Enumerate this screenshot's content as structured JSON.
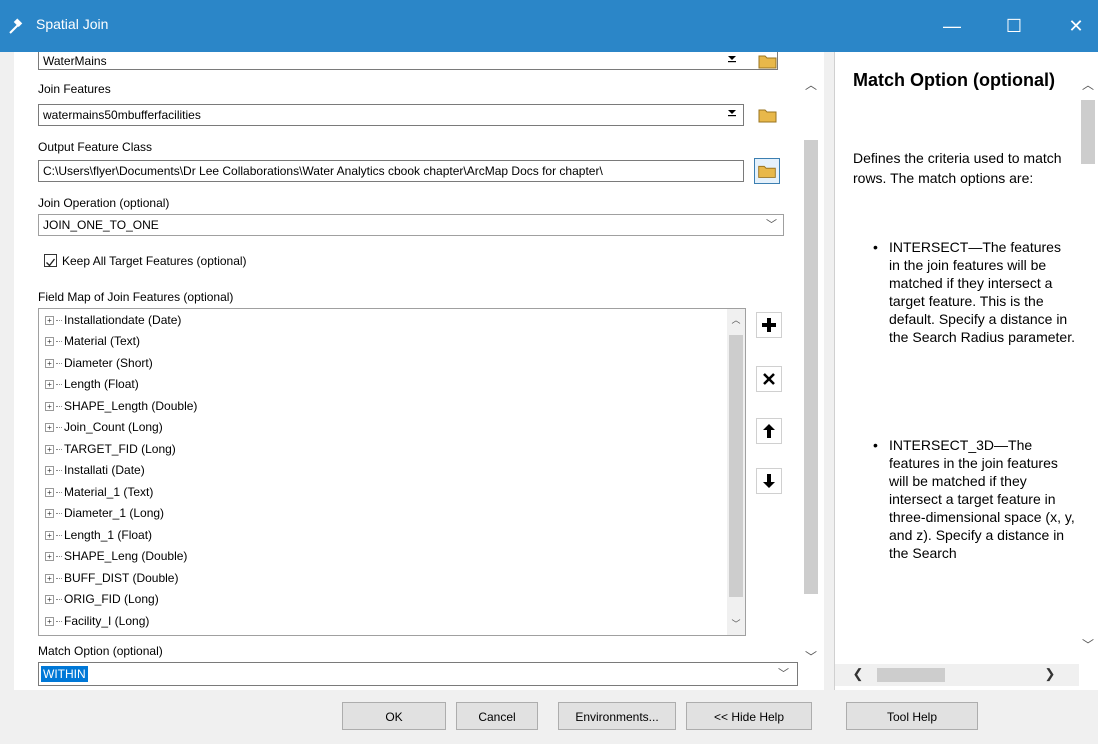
{
  "window": {
    "title": "Spatial Join",
    "minimize_glyph": "—",
    "maximize_glyph": "☐",
    "close_glyph": "✕"
  },
  "form": {
    "target_features_value": "WaterMains",
    "join_features_label": "Join Features",
    "join_features_value": "watermains50mbufferfacilities",
    "output_label": "Output Feature Class",
    "output_value": "C:\\Users\\flyer\\Documents\\Dr Lee Collaborations\\Water Analytics cbook chapter\\ArcMap Docs for chapter\\",
    "join_operation_label": "Join Operation (optional)",
    "join_operation_value": "JOIN_ONE_TO_ONE",
    "keep_all_label": "Keep All Target Features (optional)",
    "keep_all_checked": true,
    "field_map_label": "Field Map of Join Features (optional)",
    "field_map_items": [
      "Installationdate (Date)",
      "Material (Text)",
      "Diameter (Short)",
      "Length (Float)",
      "SHAPE_Length (Double)",
      "Join_Count (Long)",
      "TARGET_FID (Long)",
      "Installati (Date)",
      "Material_1 (Text)",
      "Diameter_1 (Long)",
      "Length_1 (Float)",
      "SHAPE_Leng (Double)",
      "BUFF_DIST (Double)",
      "ORIG_FID (Long)",
      "Facility_I (Long)"
    ],
    "match_option_label": "Match Option (optional)",
    "match_option_value": "WITHIN"
  },
  "help": {
    "title": "Match Option (optional)",
    "description": "Defines the criteria used to match rows. The match options are:",
    "bullets": [
      "INTERSECT—The features in the join features will be matched if they intersect a target feature. This is the default. Specify a distance in the Search Radius parameter.",
      "INTERSECT_3D—The features in the join features will be matched if they intersect a target feature in three-dimensional space (x, y, and z). Specify a distance in the Search"
    ]
  },
  "buttons": {
    "ok": "OK",
    "cancel": "Cancel",
    "environments": "Environments...",
    "hide_help": "<< Hide Help",
    "tool_help": "Tool Help"
  },
  "colors": {
    "titlebar": "#2b86c8",
    "selection": "#0078d7",
    "folder": "#e8b84a"
  },
  "icons": {
    "app": "hammer-icon",
    "folder": "folder-open-icon",
    "add": "plus-icon",
    "remove": "x-icon",
    "up": "arrow-up-icon",
    "down": "arrow-down-icon"
  }
}
